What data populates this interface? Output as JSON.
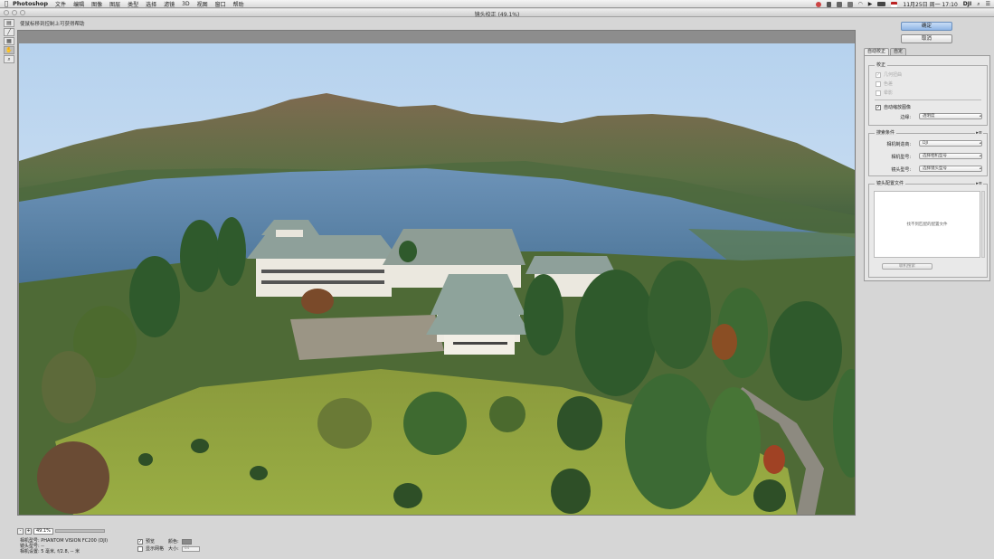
{
  "menubar": {
    "app_name": "Photoshop",
    "items": [
      "文件",
      "编辑",
      "图像",
      "图层",
      "类型",
      "选择",
      "滤镜",
      "3D",
      "视图",
      "窗口",
      "帮助"
    ],
    "clock": "11月25日 周一  17:10",
    "user": "DJI"
  },
  "dialog": {
    "title": "镜头校正 (49.1%)",
    "hint": "使鼠标移到控制上可获得帮助",
    "ok_label": "确定",
    "cancel_label": "取消"
  },
  "tools": [
    "remove-distortion-tool",
    "straighten-tool",
    "move-grid-tool",
    "hand-tool",
    "zoom-tool"
  ],
  "zoom": {
    "value": "49.1%"
  },
  "camera_info": {
    "camera_model": "相机型号: PHANTOM VISION FC200 (DJI)",
    "lens_model": "镜头型号: --",
    "camera_settings": "相机设置: 5 毫米, f/2.8, -- 米"
  },
  "preview_options": {
    "preview_label": "预览",
    "preview_checked": true,
    "show_grid_label": "显示网格",
    "show_grid_checked": false,
    "color_label": "颜色:",
    "grid_color": "#8a8a8a",
    "size_label": "大小:",
    "size_value": "64"
  },
  "panel": {
    "tabs": [
      {
        "label": "自动校正",
        "active": true
      },
      {
        "label": "自定",
        "active": false
      }
    ],
    "correction": {
      "title": "校正",
      "geometric_label": "几何扭曲",
      "chromatic_label": "色差",
      "vignette_label": "晕影",
      "auto_scale_label": "自动缩放图像",
      "auto_scale_checked": true,
      "edge_label": "边缘:",
      "edge_value": "透明度"
    },
    "search_criteria": {
      "title": "搜索条件",
      "camera_make_label": "相机制造商:",
      "camera_make_value": "DJI",
      "camera_model_label": "相机型号:",
      "camera_model_value": "选择相机型号",
      "lens_model_label": "镜头型号:",
      "lens_model_value": "选择镜头型号"
    },
    "lens_profiles": {
      "title": "镜头配置文件",
      "empty_text": "找不到匹配的配置文件",
      "search_online_label": "联机搜索"
    }
  },
  "colors": {
    "ok_button": "#a9c8ee",
    "sky": "#c8def4",
    "lake": "#5c86ad"
  }
}
